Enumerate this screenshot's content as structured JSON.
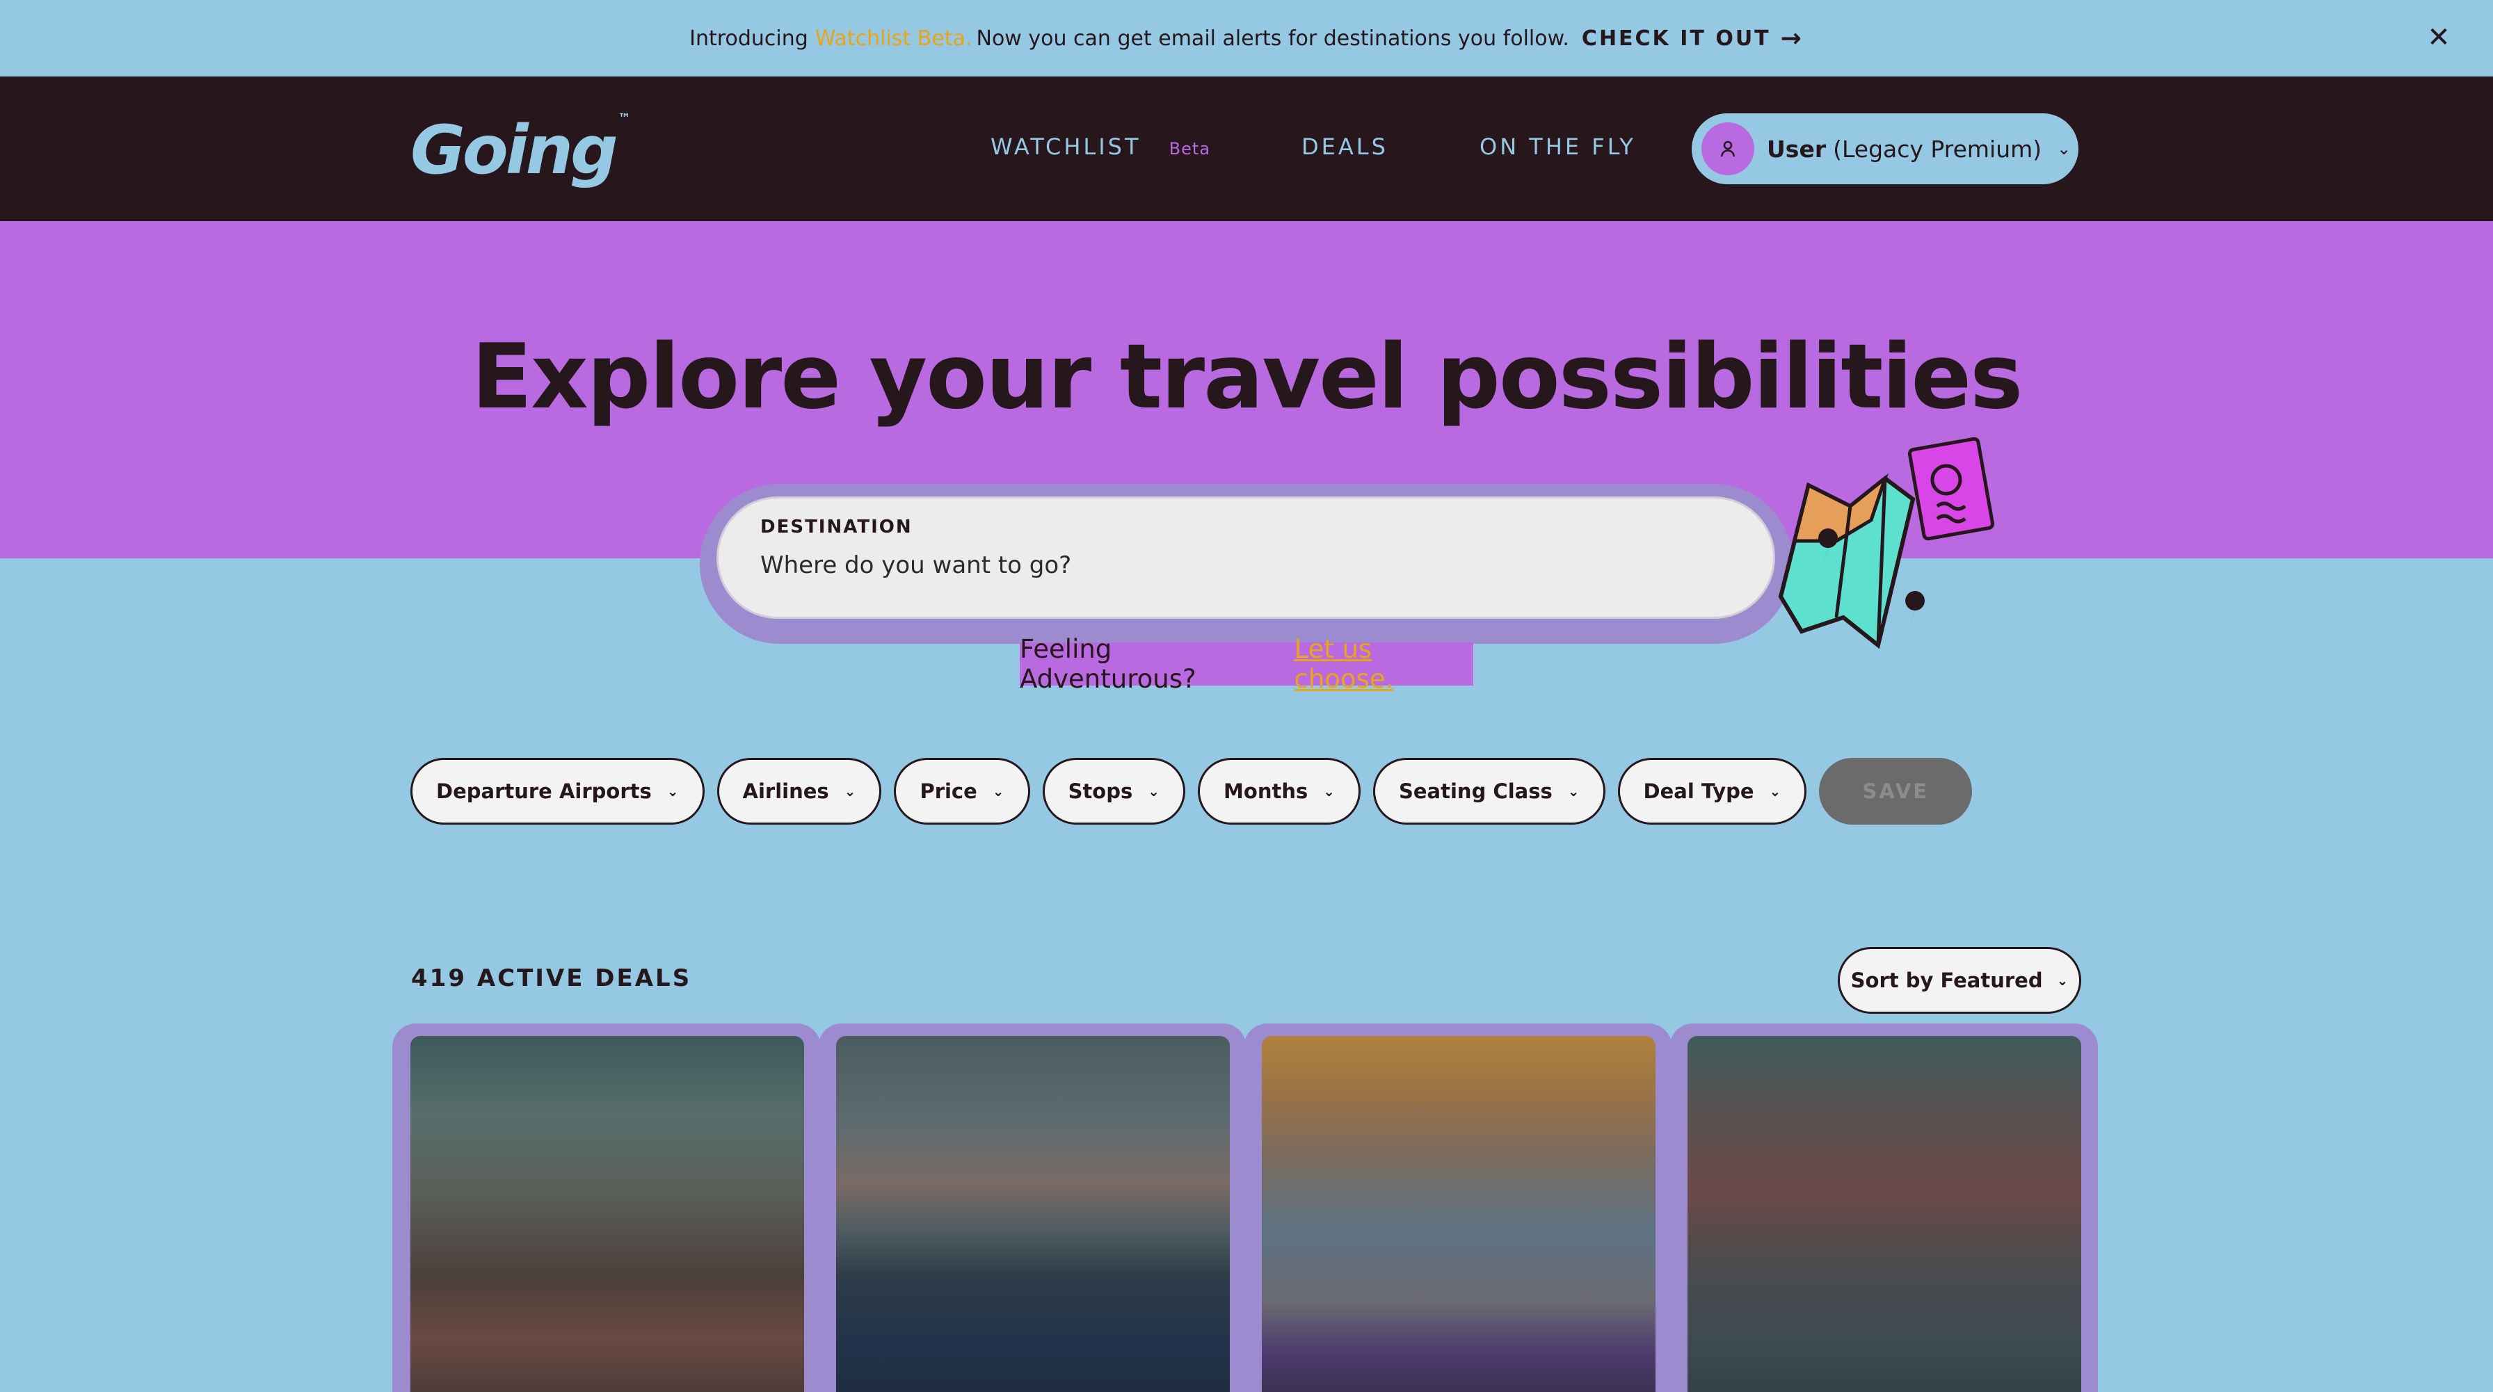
{
  "banner": {
    "intro": "Introducing",
    "highlight": "Watchlist Beta.",
    "message": "Now you can get email alerts for destinations you follow.",
    "cta": "CHECK IT OUT",
    "cta_icon": "arrow-right-icon",
    "close_icon": "close-icon"
  },
  "nav": {
    "logo": "Going",
    "logo_tm": "™",
    "links": [
      {
        "label": "WATCHLIST",
        "badge": "Beta"
      },
      {
        "label": "DEALS"
      },
      {
        "label": "ON THE FLY"
      }
    ],
    "user": {
      "name": "User",
      "plan": "(Legacy Premium)",
      "icon": "user-icon",
      "chevron": "chevron-down-icon"
    }
  },
  "hero": {
    "title": "Explore your travel possibilities"
  },
  "search": {
    "label": "DESTINATION",
    "placeholder": "Where do you want to go?"
  },
  "adventure": {
    "text": "Feeling Adventurous?",
    "link": "Let us choose."
  },
  "filters": [
    {
      "label": "Departure Airports"
    },
    {
      "label": "Airlines"
    },
    {
      "label": "Price"
    },
    {
      "label": "Stops"
    },
    {
      "label": "Months"
    },
    {
      "label": "Seating Class"
    },
    {
      "label": "Deal Type"
    }
  ],
  "save_label": "SAVE",
  "deals": {
    "count": "419 ACTIVE DEALS",
    "sort": "Sort by Featured"
  },
  "colors": {
    "sky": "#95c8e3",
    "nav": "#27171d",
    "purple": "#b96ae0",
    "gold": "#e8a51c",
    "ink": "#25171c"
  }
}
